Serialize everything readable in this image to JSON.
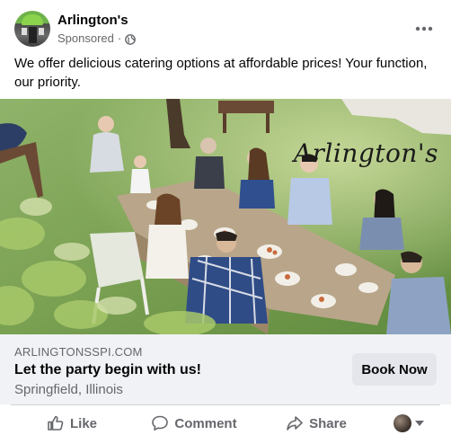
{
  "post": {
    "page_name": "Arlington's",
    "sponsored_label": "Sponsored",
    "separator": "·",
    "text": "We offer delicious catering options at affordable prices! Your function, our priority.",
    "image_overlay_text": "Arlington's"
  },
  "link": {
    "domain": "ARLINGTONSSPI.COM",
    "headline": "Let the party begin with us!",
    "location": "Springfield, Illinois",
    "cta_label": "Book Now"
  },
  "actions": {
    "like": "Like",
    "comment": "Comment",
    "share": "Share"
  },
  "colors": {
    "secondary_text": "#65676b",
    "strip_bg": "#f0f2f5",
    "button_bg": "#e4e6eb"
  },
  "icons": [
    "globe-icon",
    "more-options-icon",
    "like-icon",
    "comment-icon",
    "share-icon",
    "dropdown-caret-icon"
  ]
}
